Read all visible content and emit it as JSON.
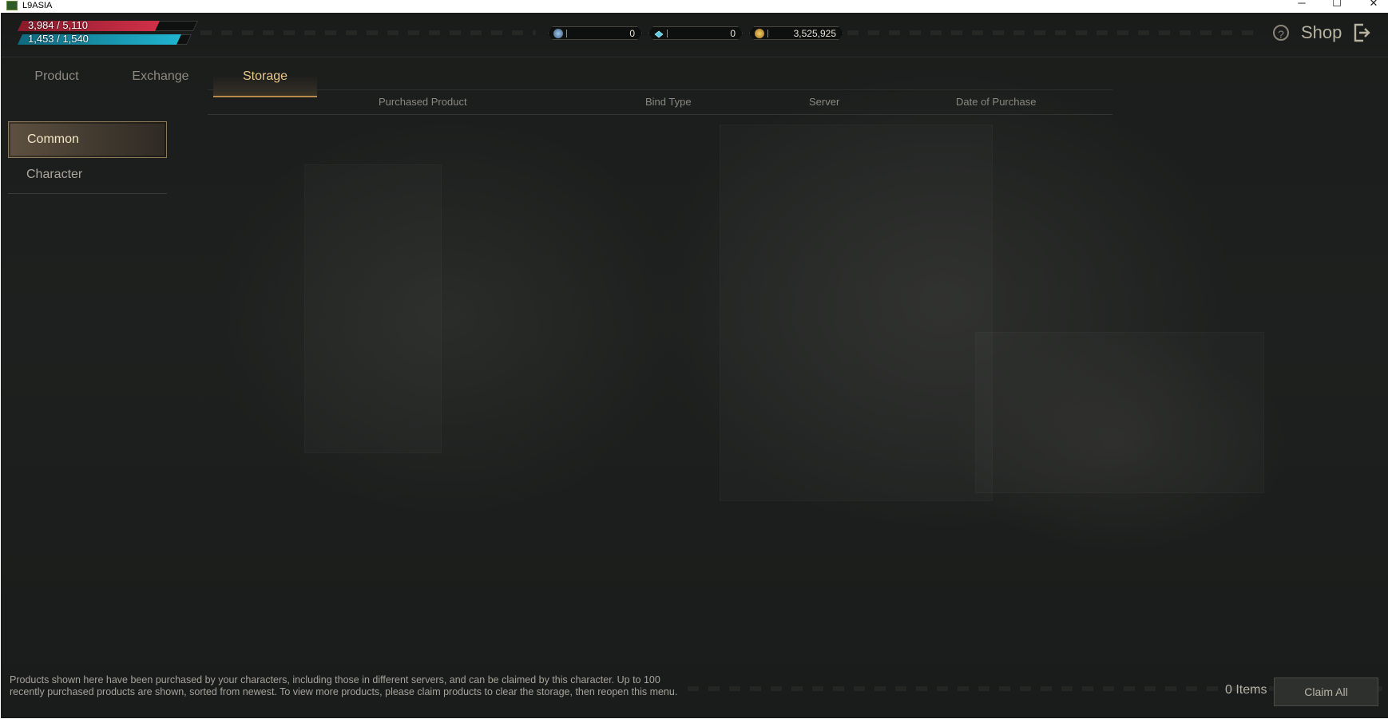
{
  "window": {
    "title": "L9ASIA",
    "minimize": "─",
    "maximize": "☐",
    "close": "✕"
  },
  "hud": {
    "hp_text": "3,984 / 5,110",
    "hp_fraction": 0.78,
    "mp_text": "1,453 / 1,540",
    "mp_fraction": 0.94,
    "currencies": [
      {
        "icon": "blue-orb-icon",
        "value": "0"
      },
      {
        "icon": "diamond-icon",
        "value": "0"
      },
      {
        "icon": "gold-coin-icon",
        "value": "3,525,925"
      }
    ],
    "help_glyph": "?",
    "shop_label": "Shop"
  },
  "tabs": [
    {
      "label": "Product"
    },
    {
      "label": "Exchange"
    },
    {
      "label": "Storage"
    }
  ],
  "active_tab": "Storage",
  "table": {
    "columns": [
      "Purchased Product",
      "Bind Type",
      "Server",
      "Date of Purchase"
    ]
  },
  "categories": [
    {
      "label": "Common"
    },
    {
      "label": "Character"
    }
  ],
  "active_category": "Common",
  "footer": {
    "note": "Products shown here have been purchased by your characters, including those in different servers, and can be claimed by this character. Up to 100 recently purchased products are shown, sorted from newest. To view more products, please claim products to clear the storage, then reopen this menu.",
    "items_count": "0 Items",
    "claim_all": "Claim All"
  },
  "colors": {
    "accent": "#e8c98a",
    "hp": "#c0283c",
    "mp": "#1a9cb5"
  }
}
